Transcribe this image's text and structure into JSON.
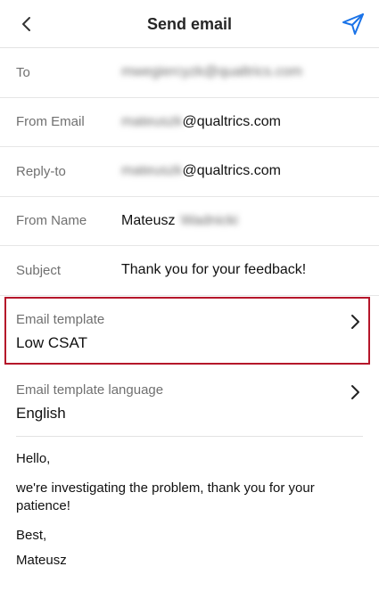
{
  "header": {
    "title": "Send email"
  },
  "icons": {
    "back": "chevron-left-icon",
    "send": "paper-plane-icon",
    "chevron": "chevron-right-icon",
    "accent_color": "#1a73e8"
  },
  "fields": {
    "to": {
      "label": "To",
      "value": "mwegiercyzk@qualtrics.com"
    },
    "from_email": {
      "label": "From Email",
      "value_hidden": "mateuszk",
      "value_domain": "@qualtrics.com"
    },
    "reply_to": {
      "label": "Reply-to",
      "value_hidden": "mateuszk",
      "value_domain": "@qualtrics.com"
    },
    "from_name": {
      "label": "From Name",
      "value": "Mateusz",
      "value_hidden": "Wadnicki"
    },
    "subject": {
      "label": "Subject",
      "value": "Thank you for your feedback!"
    }
  },
  "template": {
    "label": "Email template",
    "value": "Low CSAT",
    "highlight_color": "#b5162a"
  },
  "template_language": {
    "label": "Email template language",
    "value": "English"
  },
  "message": {
    "greeting": "Hello,",
    "body": "we're investigating the problem, thank you for your patience!",
    "closing": "Best,",
    "signature": "Mateusz"
  }
}
